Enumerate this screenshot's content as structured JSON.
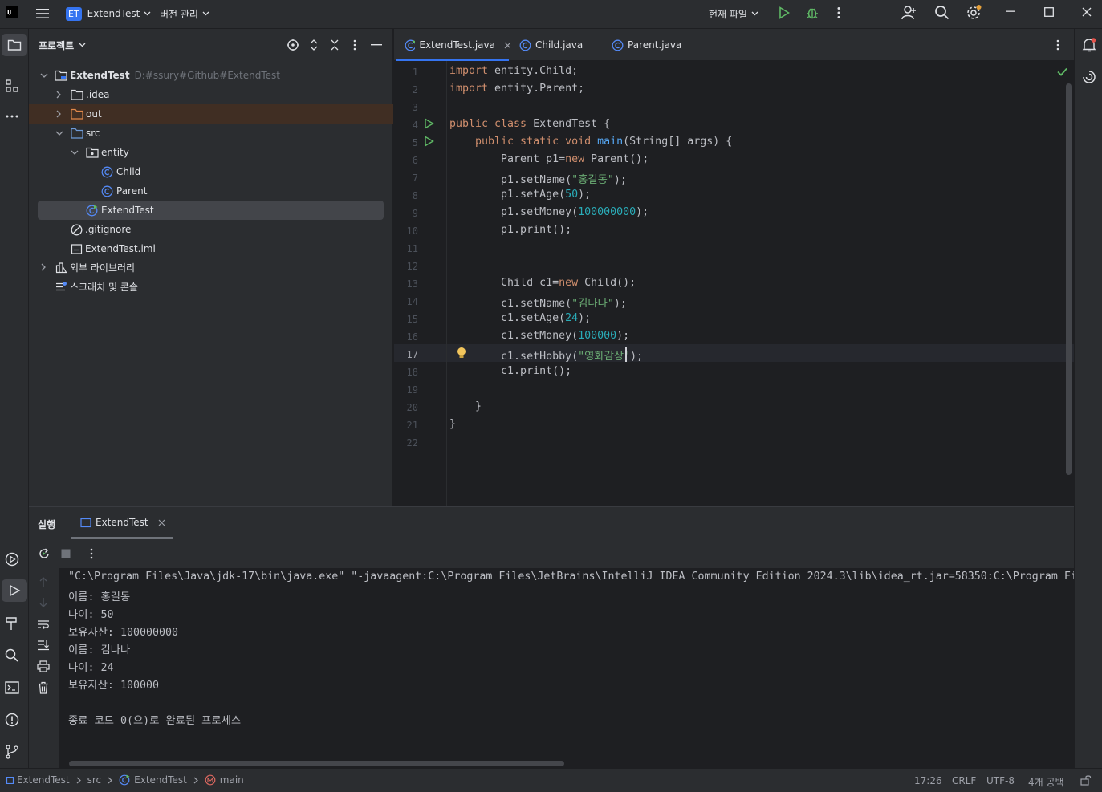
{
  "app": {
    "logo": "IJ",
    "project_badge": "ET",
    "project_name": "ExtendTest",
    "vcs_menu": "버전 관리",
    "run_config": "현재 파일"
  },
  "project_panel": {
    "title": "프로젝트",
    "tree": [
      {
        "label": "ExtendTest",
        "path": "D:#ssury#Github#ExtendTest"
      },
      {
        "label": ".idea"
      },
      {
        "label": "out"
      },
      {
        "label": "src"
      },
      {
        "label": "entity"
      },
      {
        "label": "Child"
      },
      {
        "label": "Parent"
      },
      {
        "label": "ExtendTest"
      },
      {
        "label": ".gitignore"
      },
      {
        "label": "ExtendTest.iml"
      },
      {
        "label": "외부 라이브러리"
      },
      {
        "label": "스크래치 및 콘솔"
      }
    ]
  },
  "editor": {
    "tabs": [
      {
        "label": "ExtendTest.java"
      },
      {
        "label": "Child.java"
      },
      {
        "label": "Parent.java"
      }
    ],
    "line_numbers": [
      "1",
      "2",
      "3",
      "4",
      "5",
      "6",
      "7",
      "8",
      "9",
      "10",
      "11",
      "12",
      "13",
      "14",
      "15",
      "16",
      "17",
      "18",
      "19",
      "20",
      "21",
      "22"
    ],
    "code": {
      "l1a": "import",
      "l1b": " entity.Child;",
      "l2a": "import",
      "l2b": " entity.Parent;",
      "l4a": "public class",
      "l4b": " ExtendTest {",
      "l5a": "    public static void",
      "l5b": " main",
      "l5c": "(String[] args) {",
      "l6a": "        Parent p1=",
      "l6b": "new",
      "l6c": " Parent();",
      "l7a": "        p1.setName(",
      "l7b": "\"홍길동\"",
      "l7c": ");",
      "l8a": "        p1.setAge(",
      "l8b": "50",
      "l8c": ");",
      "l9a": "        p1.setMoney(",
      "l9b": "100000000",
      "l9c": ");",
      "l10": "        p1.print();",
      "l13a": "        Child c1=",
      "l13b": "new",
      "l13c": " Child();",
      "l14a": "        c1.setName(",
      "l14b": "\"김나나\"",
      "l14c": ");",
      "l15a": "        c1.setAge(",
      "l15b": "24",
      "l15c": ");",
      "l16a": "        c1.setMoney(",
      "l16b": "100000",
      "l16c": ");",
      "l17a": "        c1.setHobby(",
      "l17b": "\"영화감상\"",
      "l17c": ");",
      "l18": "        c1.print();",
      "l20": "    }",
      "l21": "}"
    }
  },
  "run_panel": {
    "title": "실행",
    "tab": "ExtendTest",
    "output": [
      "\"C:\\Program Files\\Java\\jdk-17\\bin\\java.exe\" \"-javaagent:C:\\Program Files\\JetBrains\\IntelliJ IDEA Community Edition 2024.3\\lib\\idea_rt.jar=58350:C:\\Program Fi",
      "이름: 홍길동",
      "나이: 50",
      "보유자산: 100000000",
      "이름: 김나나",
      "나이: 24",
      "보유자산: 100000",
      "",
      "종료 코드 0(으)로 완료된 프로세스"
    ]
  },
  "status_bar": {
    "crumbs": [
      "ExtendTest",
      "src",
      "ExtendTest",
      "main"
    ],
    "position": "17:26",
    "line_sep": "CRLF",
    "encoding": "UTF-8",
    "indent": "4개 공백"
  },
  "colors": {
    "accent": "#3574f0",
    "keyword": "#cf8e6d",
    "string": "#6aab73",
    "number": "#2aacb8",
    "function": "#56a8f5",
    "run_green": "#5fb865"
  }
}
